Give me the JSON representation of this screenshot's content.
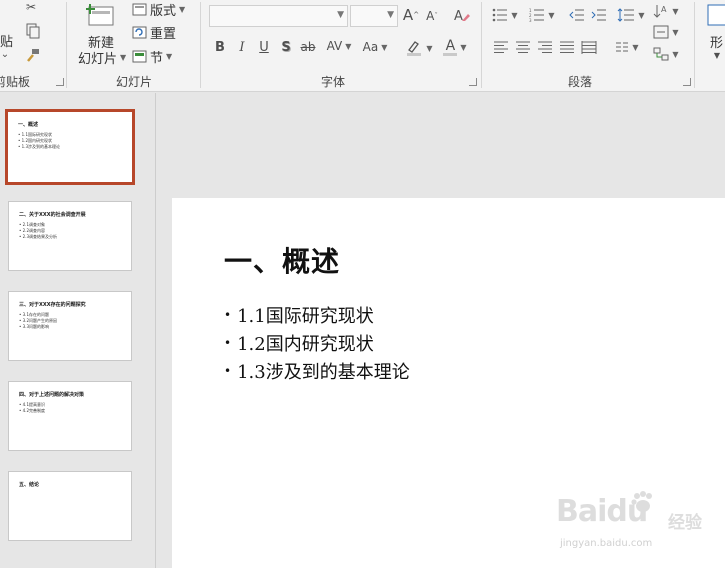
{
  "ribbon": {
    "clipboard": {
      "paste_label": "贴",
      "paste_arrow": "⌄",
      "group_label": "剪贴板"
    },
    "slides": {
      "new_slide_label": "新建",
      "new_slide_label2": "幻灯片",
      "layout_label": "版式",
      "reset_label": "重置",
      "section_label": "节",
      "group_label": "幻灯片"
    },
    "font": {
      "font_name": "",
      "font_size": "",
      "increase_size": "A",
      "decrease_size": "A",
      "bold": "B",
      "italic": "I",
      "underline": "U",
      "shadow": "S",
      "strike": "ab",
      "spacing": "AV",
      "change_case": "Aa",
      "font_color": "A",
      "group_label": "字体"
    },
    "paragraph": {
      "group_label": "段落"
    },
    "shape": {
      "label": "形"
    }
  },
  "thumbnails": [
    {
      "index": 1,
      "title": "一、概述",
      "lines": [
        "• 1.1国际研究现状",
        "• 1.2国内研究现状",
        "• 1.3涉及到的基本理论"
      ],
      "selected": true
    },
    {
      "index": 2,
      "title": "二、关于XXX的社会调查开展",
      "lines": [
        "• 2.1调查对象",
        "• 2.2调查内容",
        "• 2.3调查结果及分析"
      ],
      "selected": false
    },
    {
      "index": 3,
      "title": "三、对于XXX存在的问题探究",
      "lines": [
        "• 3.1存在的问题",
        "• 3.2问题产生的原因",
        "• 3.3问题的影响"
      ],
      "selected": false
    },
    {
      "index": 4,
      "title": "四、对于上述问题的解决对策",
      "lines": [
        "• 4.1提高意识",
        "• 4.2完善制度"
      ],
      "selected": false
    },
    {
      "index": 5,
      "title": "五、结论",
      "lines": [],
      "selected": false
    }
  ],
  "slide": {
    "title": "一、概述",
    "bullets": [
      "1.1国际研究现状",
      "1.2国内研究现状",
      "1.3涉及到的基本理论"
    ]
  },
  "watermark": {
    "brand": "Baidu",
    "cn": "经验",
    "url": "jingyan.baidu.com"
  },
  "colors": {
    "selected_thumb_border": "#b7472a",
    "ribbon_bg": "#f3f3f3",
    "workspace_bg": "#e6e6e6"
  }
}
